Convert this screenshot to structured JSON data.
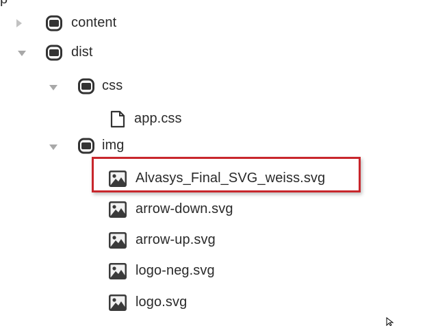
{
  "top_fragment": "p",
  "tree": [
    {
      "label": "content",
      "icon": "folder-icon",
      "arrow": "collapsed"
    },
    {
      "label": "dist",
      "icon": "folder-icon",
      "arrow": "expanded"
    },
    {
      "label": "css",
      "icon": "folder-icon",
      "arrow": "expanded"
    },
    {
      "label": "app.css",
      "icon": "file-icon"
    },
    {
      "label": "img",
      "icon": "folder-icon",
      "arrow": "expanded"
    },
    {
      "label": "Alvasys_Final_SVG_weiss.svg",
      "icon": "image-icon",
      "highlighted": true
    },
    {
      "label": "arrow-down.svg",
      "icon": "image-icon"
    },
    {
      "label": "arrow-up.svg",
      "icon": "image-icon"
    },
    {
      "label": "logo-neg.svg",
      "icon": "image-icon"
    },
    {
      "label": "logo.svg",
      "icon": "image-icon"
    }
  ],
  "colors": {
    "highlight_border": "#c8262c",
    "arrow": "#b8b8b8",
    "folder": "#333333",
    "text": "#2a2a2a"
  }
}
